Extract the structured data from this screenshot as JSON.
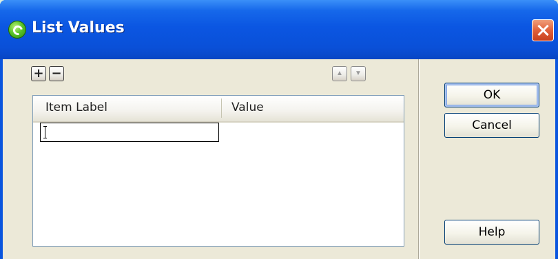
{
  "window": {
    "title": "List Values",
    "app_icon": "dreamweaver-app-icon",
    "close_icon": "close-icon"
  },
  "toolbar": {
    "add_label": "+",
    "remove_label": "−",
    "move_up_icon": "triangle-up-icon",
    "move_down_icon": "triangle-down-icon"
  },
  "list": {
    "columns": [
      "Item Label",
      "Value"
    ],
    "rows": [
      {
        "item_label": "",
        "value": ""
      }
    ]
  },
  "buttons": {
    "ok": "OK",
    "cancel": "Cancel",
    "help": "Help"
  },
  "colors": {
    "titlebar_blue": "#0a55de",
    "close_red": "#e0603a",
    "dialog_face": "#ece9d8"
  }
}
